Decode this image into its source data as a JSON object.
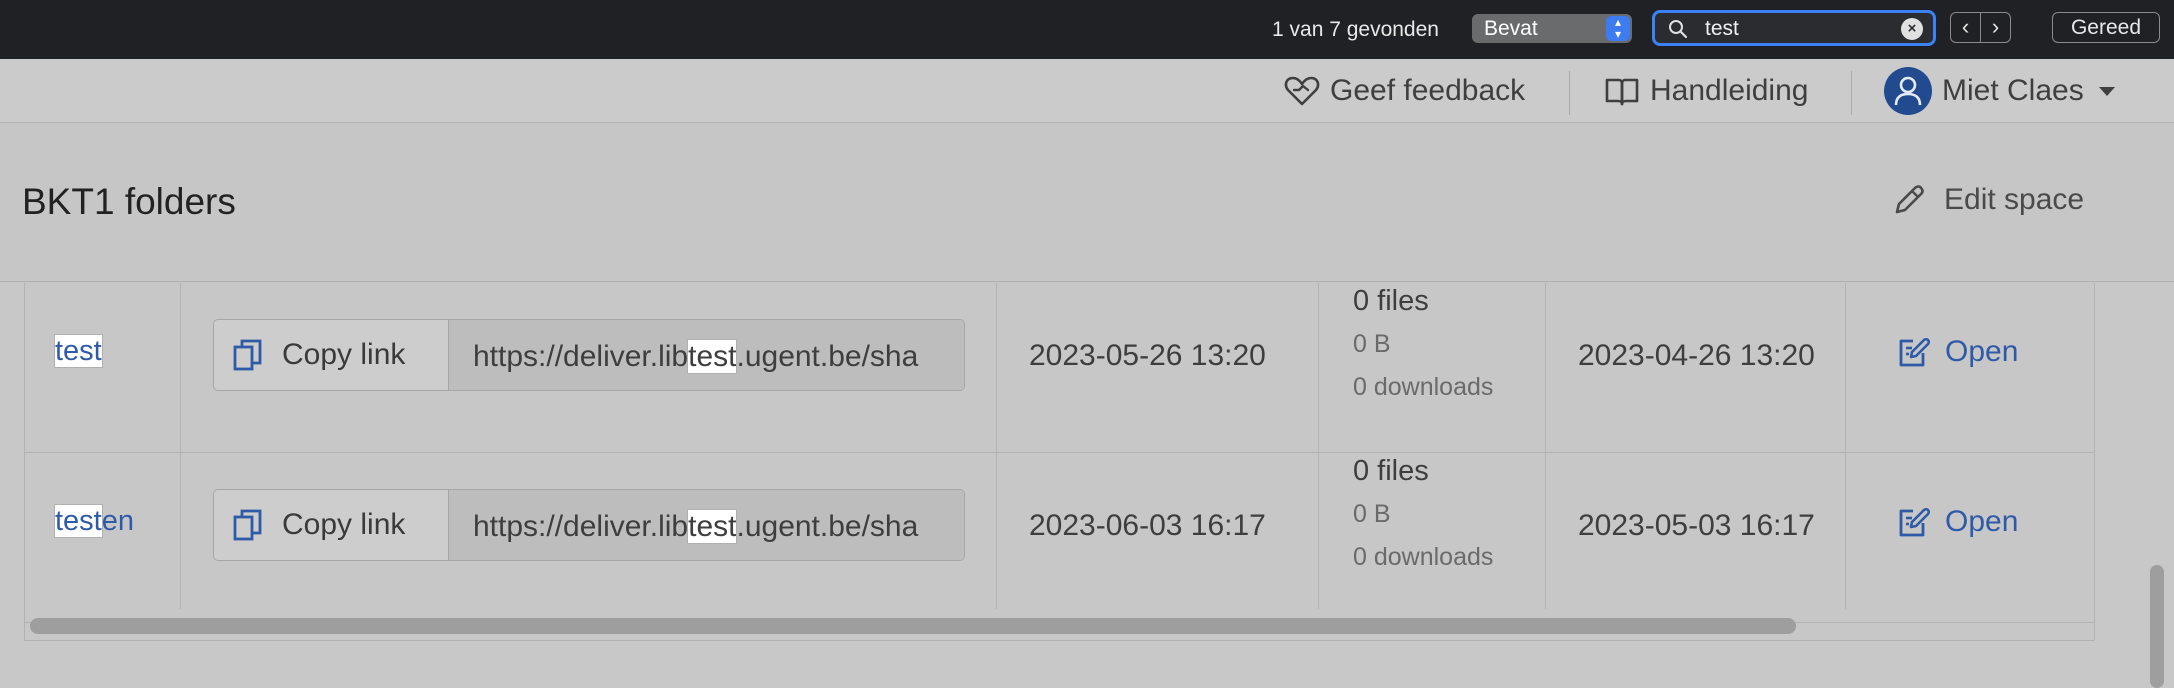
{
  "find_bar": {
    "result_count": "1 van 7 gevonden",
    "mode": "Bevat",
    "query": "test",
    "done_label": "Gereed"
  },
  "top_nav": {
    "feedback": "Geef feedback",
    "manual": "Handleiding",
    "user": "Miet Claes"
  },
  "page": {
    "title": "BKT1 folders",
    "edit_label": "Edit space"
  },
  "rows": [
    {
      "name_match": "test",
      "name_rest": "",
      "copy_label": "Copy link",
      "url_pre": "https://deliver.lib",
      "url_match": "test",
      "url_post": ".ugent.be/sha",
      "expires": "2023-05-26 13:20",
      "files": "0 files",
      "size": "0 B",
      "downloads": "0 downloads",
      "created": "2023-04-26 13:20",
      "open_label": "Open"
    },
    {
      "name_match": "test",
      "name_rest": "en",
      "copy_label": "Copy link",
      "url_pre": "https://deliver.lib",
      "url_match": "test",
      "url_post": ".ugent.be/sha",
      "expires": "2023-06-03 16:17",
      "files": "0 files",
      "size": "0 B",
      "downloads": "0 downloads",
      "created": "2023-05-03 16:17",
      "open_label": "Open"
    }
  ],
  "colors": {
    "accent": "#3b82f6",
    "link": "#2e5aa8",
    "avatar": "#214a8f"
  }
}
